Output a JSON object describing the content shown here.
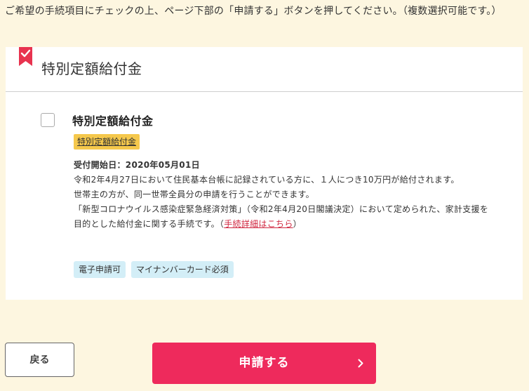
{
  "instruction": "ご希望の手続項目にチェックの上、ページ下部の「申請する」ボタンを押してください。（複数選択可能です。）",
  "section": {
    "title": "特別定額給付金",
    "bookmark_color": "#e8334f"
  },
  "item": {
    "checked": false,
    "title": "特別定額給付金",
    "category": "特別定額給付金",
    "start_label": "受付開始日：2020年05月01日",
    "desc_1": "令和2年4月27日において住民基本台帳に記録されている方に、１人につき10万円が給付されます。",
    "desc_2": "世帯主の方が、同一世帯全員分の申請を行うことができます。",
    "desc_3": "「新型コロナウイルス感染症緊急経済対策」（令和2年4月20日閣議決定）において定められた、家計支援を目的とした給付金に関する手続です。",
    "detail_open": "（",
    "detail_link": "手続詳細はこちら",
    "detail_close": "）",
    "badges": [
      "電子申請可",
      "マイナンバーカード必須"
    ]
  },
  "buttons": {
    "back": "戻る",
    "submit": "申請する"
  },
  "colors": {
    "page_bg": "#fdf6e0",
    "accent": "#ee2a5c",
    "tag_bg": "#f5c84c",
    "badge_bg": "#d3eef7",
    "link": "#d0263f"
  }
}
